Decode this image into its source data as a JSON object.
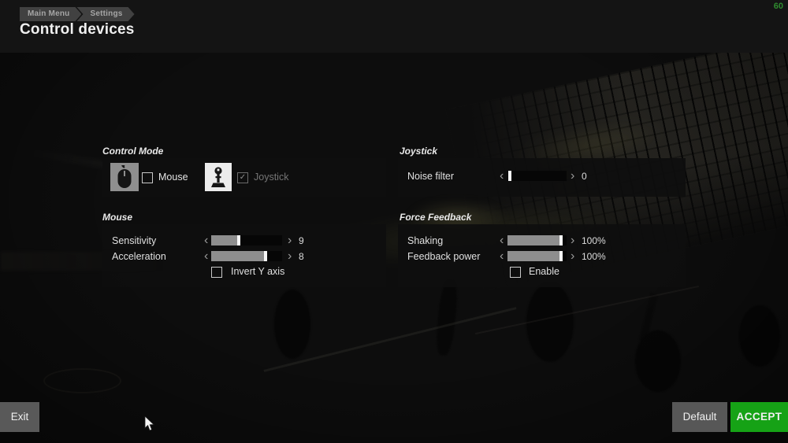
{
  "header": {
    "breadcrumb": [
      {
        "label": "Main Menu"
      },
      {
        "label": "Settings"
      }
    ],
    "title": "Control devices",
    "fps": "60"
  },
  "ui": {
    "arrow_left": "‹",
    "arrow_right": "›",
    "check_glyph": "✓"
  },
  "colors": {
    "accent_green": "#16a216",
    "fps_green": "#2f8b2f",
    "slider_fill": "#8e8e8e",
    "button_gray": "#595959"
  },
  "panels": {
    "control_mode": {
      "title": "Control Mode",
      "options": [
        {
          "label": "Mouse",
          "checked": false,
          "icon": "mouse-icon",
          "enabled": true
        },
        {
          "label": "Joystick",
          "checked": true,
          "icon": "joystick-icon",
          "enabled": false
        }
      ]
    },
    "joystick": {
      "title": "Joystick",
      "sliders": [
        {
          "label": "Noise filter",
          "value": "0",
          "fill_pct": 0
        }
      ]
    },
    "mouse": {
      "title": "Mouse",
      "sliders": [
        {
          "label": "Sensitivity",
          "value": "9",
          "fill_pct": 40
        },
        {
          "label": "Acceleration",
          "value": "8",
          "fill_pct": 78
        }
      ],
      "checkbox": {
        "label": "Invert Y axis",
        "checked": false
      }
    },
    "force_feedback": {
      "title": "Force Feedback",
      "sliders": [
        {
          "label": "Shaking",
          "value": "100%",
          "fill_pct": 92
        },
        {
          "label": "Feedback power",
          "value": "100%",
          "fill_pct": 92
        }
      ],
      "checkbox": {
        "label": "Enable",
        "checked": false
      }
    }
  },
  "footer": {
    "exit_label": "Exit",
    "default_label": "Default",
    "accept_label": "ACCEPT"
  }
}
